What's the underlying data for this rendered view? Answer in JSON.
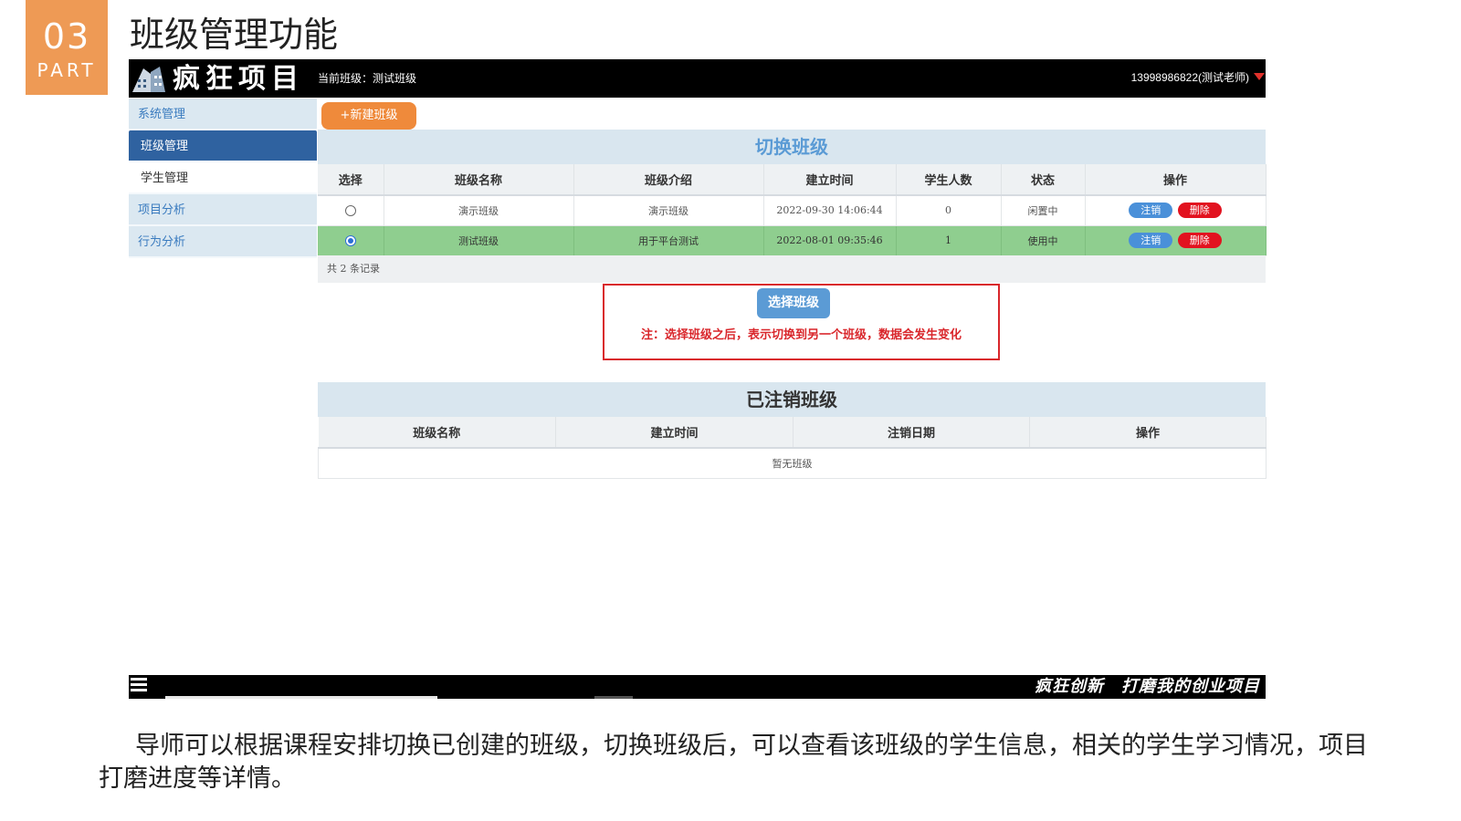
{
  "slide": {
    "part_number": "03",
    "part_label": "PART",
    "title": "班级管理功能"
  },
  "app": {
    "logo_text": "疯狂项目",
    "current_class_text": "当前班级：测试班级",
    "user_label": "13998986822(测试老师)"
  },
  "sidebar": {
    "items": [
      {
        "label": "系统管理"
      },
      {
        "label": "班级管理"
      },
      {
        "label": "学生管理"
      },
      {
        "label": "项目分析"
      },
      {
        "label": "行为分析"
      }
    ]
  },
  "toolbar": {
    "new_class_label": "+新建班级"
  },
  "switch_panel": {
    "title": "切换班级",
    "headers": [
      "选择",
      "班级名称",
      "班级介绍",
      "建立时间",
      "学生人数",
      "状态",
      "操作"
    ],
    "rows": [
      {
        "name": "演示班级",
        "intro": "演示班级",
        "created": "2022-09-30 14:06:44",
        "students": "0",
        "status": "闲置中",
        "selected": false
      },
      {
        "name": "测试班级",
        "intro": "用于平台测试",
        "created": "2022-08-01 09:35:46",
        "students": "1",
        "status": "使用中",
        "selected": true
      }
    ],
    "cancel_label": "注销",
    "delete_label": "删除",
    "record_count": "共 2 条记录"
  },
  "notice": {
    "select_button": "选择班级",
    "text": "注：选择班级之后，表示切换到另一个班级，数据会发生变化"
  },
  "cancelled_panel": {
    "title": "已注销班级",
    "headers": [
      "班级名称",
      "建立时间",
      "注销日期",
      "操作"
    ],
    "empty_text": "暂无班级"
  },
  "footer": {
    "slogan": "疯狂创新　打磨我的创业项目"
  },
  "caption": "导师可以根据课程安排切换已创建的班级，切换班级后，可以查看该班级的学生信息，相关的学生学习情况，项目打磨进度等详情。",
  "colors": {
    "part_badge": "#ee9a55",
    "new_button": "#ef8a3b",
    "selected_row": "#8fce8f",
    "notice_red": "#d9262b",
    "accent_blue": "#5b9bd5"
  }
}
